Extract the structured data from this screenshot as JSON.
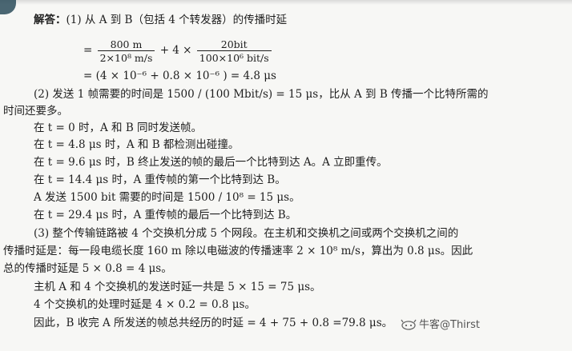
{
  "part1": {
    "heading": "解答：",
    "intro": "(1) 从 A 到 B（包括 4 个转发器）的传播时延",
    "eq_prefix": "=",
    "frac1_num": "800 m",
    "frac1_den": "2×10⁸ m/s",
    "plus_mult": "+ 4 ×",
    "frac2_num": "20bit",
    "frac2_den": "100×10⁶ bit/s",
    "result": "= (4 × 10⁻⁶ + 0.8 × 10⁻⁶ ) = 4.8 μs"
  },
  "part2": {
    "line1": "(2) 发送 1 帧需要的时间是 1500 / (100 Mbit/s) = 15 μs，比从 A 到 B 传播一个比特所需的",
    "line2": "时间还要多。",
    "events": [
      "在 t = 0 时，A 和 B 同时发送帧。",
      "在 t = 4.8 μs 时，A 和 B 都检测出碰撞。",
      "在 t = 9.6 μs 时，B 终止发送的帧的最后一个比特到达 A。A 立即重传。",
      "在 t = 14.4 μs 时，A 重传帧的第一个比特到达 B。",
      "A 发送 1500 bit 需要的时间是 1500 / 10⁸ = 15 μs。",
      "在 t = 29.4 μs 时，A 重传帧的最后一个比特到达 B。"
    ]
  },
  "part3": {
    "line1": "(3) 整个传输链路被 4 个交换机分成 5 个网段。在主机和交换机之间或两个交换机之间的",
    "line2": "传播时延是：每一段电缆长度 160 m 除以电磁波的传播速率 2 × 10⁸ m/s，算出为 0.8 μs。因此",
    "line3": "总的传播时延是 5 × 0.8 = 4 μs。",
    "line4": "主机 A 和 4 个交换机的发送时延一共是 5 × 15 = 75 μs。",
    "line5": "4 个交换机的处理时延是 4 × 0.2 = 0.8 μs。",
    "line6": "因此，B 收完 A 所发送的帧总共经历的时延 = 4 + 75 + 0.8 =79.8 μs。"
  },
  "watermark": {
    "text": "牛客@Thirst",
    "icon": "nowcoder-logo-icon"
  }
}
